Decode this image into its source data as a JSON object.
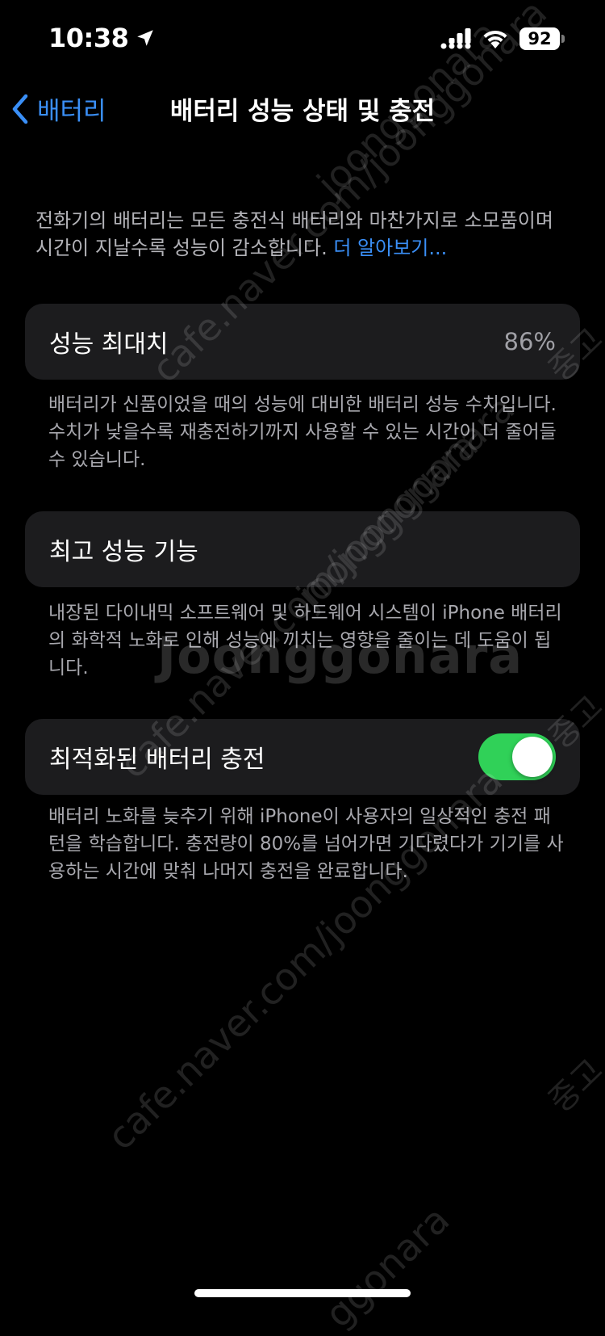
{
  "status_bar": {
    "time": "10:38",
    "battery_level": "92",
    "icons": [
      "location-arrow-icon",
      "cellular-signal-icon",
      "wifi-icon",
      "battery-icon"
    ]
  },
  "nav": {
    "back_label": "배터리",
    "title": "배터리 성능 상태 및 충전"
  },
  "intro": {
    "text": "전화기의 배터리는 모든 충전식 배터리와 마찬가지로 소모품이며 시간이 지날수록 성능이 감소합니다. ",
    "link": "더 알아보기..."
  },
  "max_capacity": {
    "label": "성능 최대치",
    "value": "86%",
    "footnote": "배터리가 신품이었을 때의 성능에 대비한 배터리 성능 수치입니다. 수치가 낮을수록 재충전하기까지 사용할 수 있는 시간이 더 줄어들 수 있습니다."
  },
  "peak_performance": {
    "label": "최고 성능 기능",
    "footnote": "내장된 다이내믹 소프트웨어 및 하드웨어 시스템이 iPhone 배터리의 화학적 노화로 인해 성능에 끼치는 영향을 줄이는 데 도움이 됩니다."
  },
  "optimized_charging": {
    "label": "최적화된 배터리 충전",
    "enabled": true,
    "footnote": "배터리 노화를 늦추기 위해 iPhone이 사용자의 일상적인 충전 패턴을 학습합니다. 충전량이 80%를 넘어가면 기다렸다가 기기를 사용하는 시간에 맞춰 나머지 충전을 완료합니다."
  },
  "watermarks": {
    "url": "cafe.naver.com/joonggonara",
    "brand": "Joonggonara",
    "partial_1": "joonggonara",
    "partial_2": "ggonara",
    "edge": "중고"
  },
  "colors": {
    "background": "#000000",
    "cell": "#1c1c1e",
    "accent_blue": "#3a8ff7",
    "toggle_on": "#30d158",
    "secondary_text": "#a8a8ae"
  }
}
